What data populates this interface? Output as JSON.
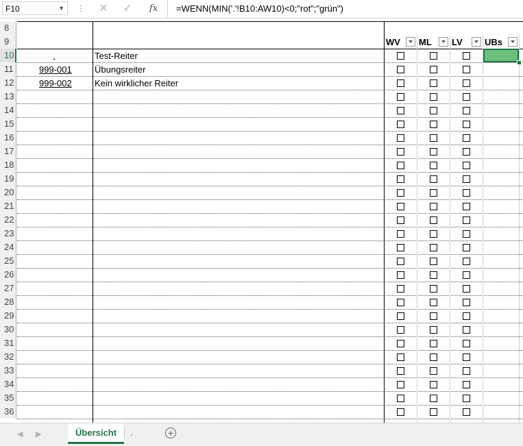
{
  "formula_bar": {
    "name_box": "F10",
    "formula": "=WENN(MIN('.'!B10:AW10)<0;\"rot\";\"grün\")",
    "icons": [
      "cancel-icon",
      "enter-icon",
      "function-icon"
    ],
    "fx_label": "fx"
  },
  "grid": {
    "row_numbers": [
      "8",
      "9",
      "10",
      "11",
      "12",
      "13",
      "14",
      "15",
      "16",
      "17",
      "18",
      "19",
      "20",
      "21",
      "22",
      "23",
      "24",
      "25",
      "26",
      "27",
      "28",
      "29",
      "30",
      "31",
      "32",
      "33",
      "34",
      "35",
      "36"
    ],
    "selected_row": "10",
    "filter_headers": [
      "WV",
      "ML",
      "LV",
      "UBs"
    ],
    "rows": [
      {
        "id": ".",
        "name": "Test-Reiter"
      },
      {
        "id": "999-001",
        "name": "Übungsreiter"
      },
      {
        "id": "999-002",
        "name": "Kein wirklicher Reiter"
      }
    ],
    "selected_cell_color": "#6cbf7b",
    "accent": "#217346"
  },
  "sheet_tabs": {
    "active": "Übersicht",
    "other": ".",
    "add_icon": "plus-circle-icon"
  }
}
